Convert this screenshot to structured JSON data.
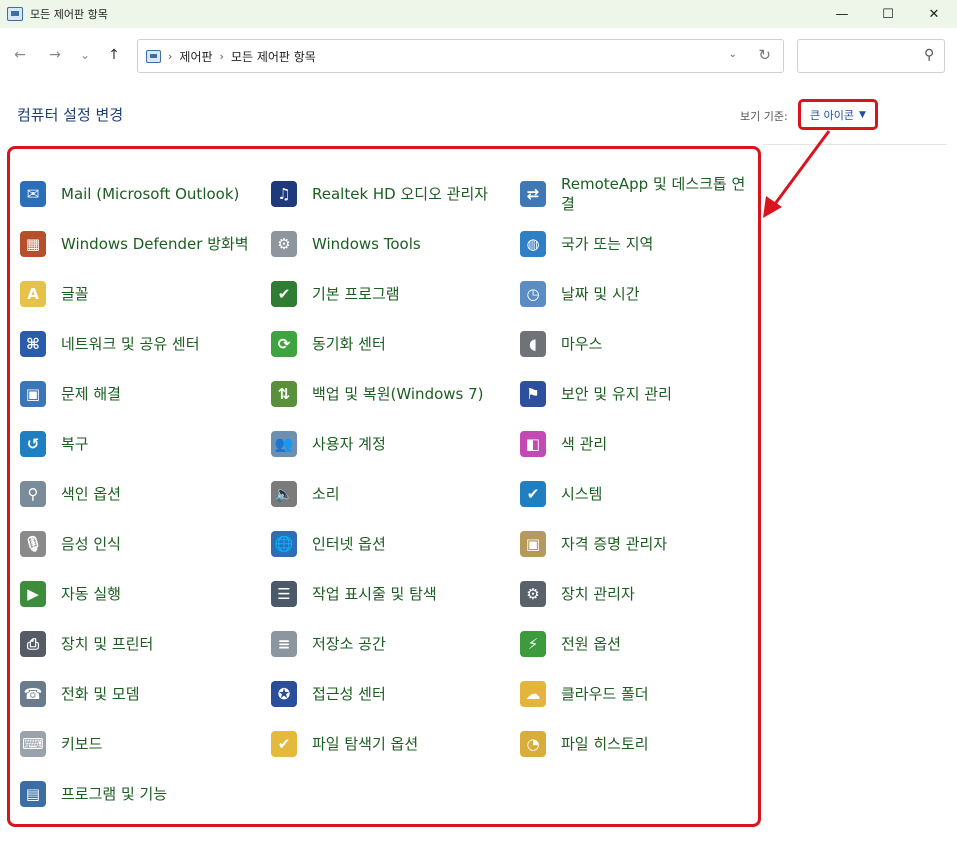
{
  "window": {
    "title": "모든 제어판 항목",
    "minimize": "—",
    "maximize": "☐",
    "close": "✕"
  },
  "nav": {
    "back": "←",
    "forward": "→",
    "recent": "⌄",
    "up": "↑",
    "breadcrumbs": [
      "제어판",
      "모든 제어판 항목"
    ],
    "dropdown": "⌄",
    "refresh": "↻",
    "search_placeholder": "",
    "search_icon": "⚲"
  },
  "header": {
    "title": "컴퓨터 설정 변경",
    "view_by_label": "보기 기준:",
    "view_by_value": "큰 아이콘"
  },
  "colors": {
    "accent_red": "#d9141e",
    "link_green": "#1b5e20",
    "heading_blue": "#1e3f7a"
  },
  "columns": [
    [
      {
        "label": "Mail (Microsoft Outlook)",
        "icon": "mail-icon"
      },
      {
        "label": "Windows Defender 방화벽",
        "icon": "firewall-icon"
      },
      {
        "label": "글꼴",
        "icon": "fonts-icon"
      },
      {
        "label": "네트워크 및 공유 센터",
        "icon": "network-icon"
      },
      {
        "label": "문제 해결",
        "icon": "troubleshoot-icon"
      },
      {
        "label": "복구",
        "icon": "recovery-icon"
      },
      {
        "label": "색인 옵션",
        "icon": "indexing-icon"
      },
      {
        "label": "음성 인식",
        "icon": "microphone-icon"
      },
      {
        "label": "자동 실행",
        "icon": "autoplay-icon"
      },
      {
        "label": "장치 및 프린터",
        "icon": "printer-icon"
      },
      {
        "label": "전화 및 모뎀",
        "icon": "phone-icon"
      },
      {
        "label": "키보드",
        "icon": "keyboard-icon"
      },
      {
        "label": "프로그램 및 기능",
        "icon": "programs-icon"
      }
    ],
    [
      {
        "label": "Realtek HD 오디오 관리자",
        "icon": "audio-manager-icon"
      },
      {
        "label": "Windows Tools",
        "icon": "tools-gear-icon"
      },
      {
        "label": "기본 프로그램",
        "icon": "default-programs-icon"
      },
      {
        "label": "동기화 센터",
        "icon": "sync-icon"
      },
      {
        "label": "백업 및 복원(Windows 7)",
        "icon": "backup-icon"
      },
      {
        "label": "사용자 계정",
        "icon": "users-icon"
      },
      {
        "label": "소리",
        "icon": "speaker-icon"
      },
      {
        "label": "인터넷 옵션",
        "icon": "internet-options-icon"
      },
      {
        "label": "작업 표시줄 및 탐색",
        "icon": "taskbar-icon"
      },
      {
        "label": "저장소 공간",
        "icon": "storage-icon"
      },
      {
        "label": "접근성 센터",
        "icon": "accessibility-icon"
      },
      {
        "label": "파일 탐색기 옵션",
        "icon": "folder-options-icon"
      }
    ],
    [
      {
        "label": "RemoteApp 및 데스크톱 연결",
        "icon": "remoteapp-icon"
      },
      {
        "label": "국가 또는 지역",
        "icon": "globe-icon"
      },
      {
        "label": "날짜 및 시간",
        "icon": "calendar-clock-icon"
      },
      {
        "label": "마우스",
        "icon": "mouse-icon"
      },
      {
        "label": "보안 및 유지 관리",
        "icon": "flag-icon"
      },
      {
        "label": "색 관리",
        "icon": "color-management-icon"
      },
      {
        "label": "시스템",
        "icon": "system-monitor-icon"
      },
      {
        "label": "자격 증명 관리자",
        "icon": "credential-vault-icon"
      },
      {
        "label": "장치 관리자",
        "icon": "device-manager-icon"
      },
      {
        "label": "전원 옵션",
        "icon": "battery-icon"
      },
      {
        "label": "클라우드 폴더",
        "icon": "cloud-folder-icon"
      },
      {
        "label": "파일 히스토리",
        "icon": "file-history-icon"
      }
    ]
  ]
}
